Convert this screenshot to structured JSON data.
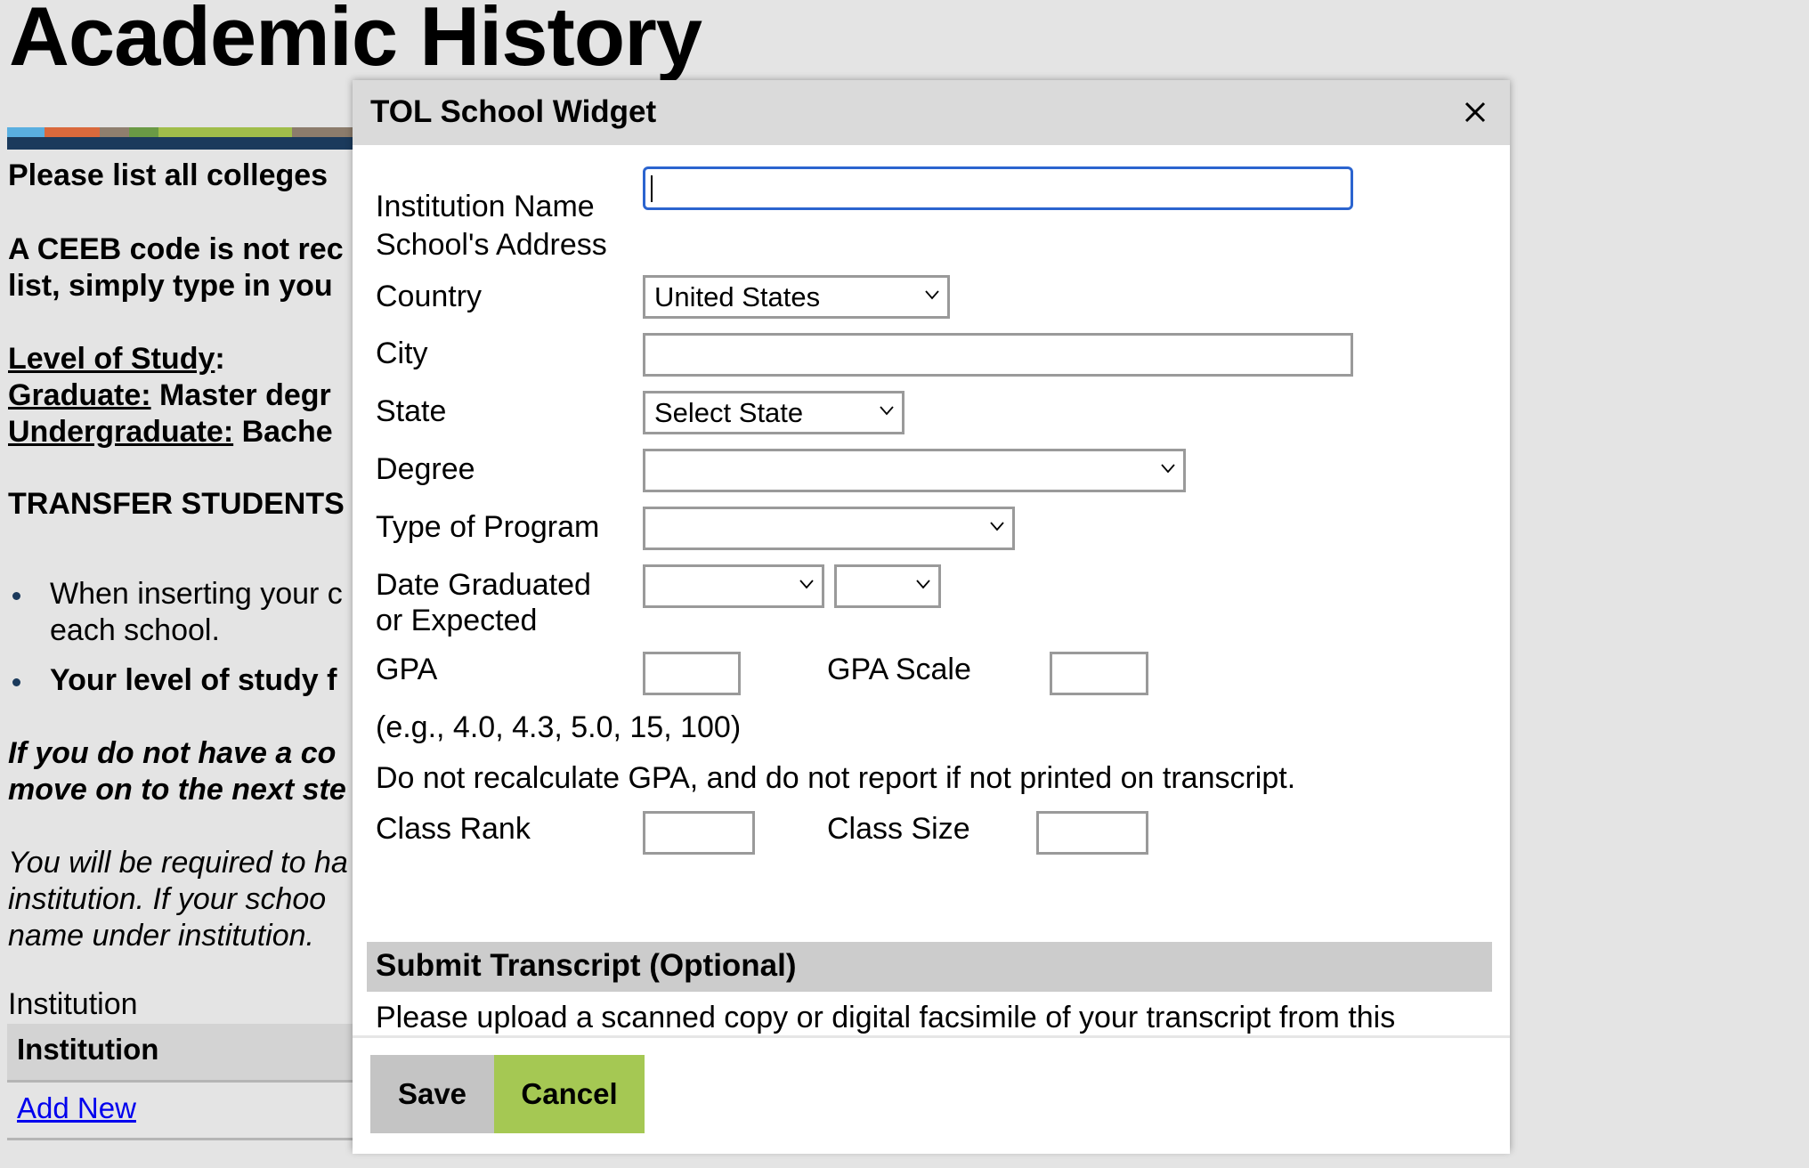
{
  "page": {
    "title": "Academic History",
    "stripe_colors": [
      "#5aafe0",
      "#d9693c",
      "#8f7f6e",
      "#6a9a45",
      "#a0bd4a",
      "#8c7c6c"
    ],
    "stripe_base_color": "#1b3a5c",
    "intro": "Please list all colleges",
    "ceeb_line1": "A CEEB code is not rec",
    "ceeb_line2": "list, simply type in you",
    "level_heading": "Level of Study",
    "level_colon": ":",
    "graduate_label": "Graduate:",
    "graduate_text": " Master degr",
    "undergrad_label": "Undergraduate:",
    "undergrad_text": " Bache",
    "transfer_heading": "TRANSFER STUDENTS",
    "bullets": [
      {
        "line1": "When inserting your c",
        "line2": "each school."
      },
      {
        "line1": "Your level of study f"
      }
    ],
    "no_college_line1": "If you do not have a co",
    "no_college_line2": "move on to the next ste",
    "required_line1": "You will be required to ha",
    "required_line2": "institution.  If your schoo",
    "required_line3": "name under institution.",
    "institution_label": "Institution",
    "table": {
      "header": "Institution",
      "add_new": "Add New"
    }
  },
  "dialog": {
    "title": "TOL School Widget",
    "close_icon": "close-icon",
    "fields": {
      "institution_name": {
        "label": "Institution Name",
        "value": ""
      },
      "address_heading": "School's Address",
      "country": {
        "label": "Country",
        "value": "United States"
      },
      "city": {
        "label": "City",
        "value": ""
      },
      "state": {
        "label": "State",
        "value": "Select State"
      },
      "degree": {
        "label": "Degree",
        "value": ""
      },
      "program_type": {
        "label": "Type of Program",
        "value": ""
      },
      "date_graduated": {
        "label_line1": "Date Graduated",
        "label_line2": "or Expected",
        "month": "",
        "year": ""
      },
      "gpa": {
        "label": "GPA",
        "value": ""
      },
      "gpa_scale": {
        "label": "GPA Scale",
        "value": ""
      },
      "gpa_example": "(e.g., 4.0, 4.3, 5.0, 15, 100)",
      "gpa_note": "Do not recalculate GPA, and do not report if not printed on transcript.",
      "class_rank": {
        "label": "Class Rank",
        "value": ""
      },
      "class_size": {
        "label": "Class Size",
        "value": ""
      }
    },
    "transcript": {
      "heading": "Submit Transcript (Optional)",
      "text": "Please upload a scanned copy or digital facsimile of your transcript from this institution. You may upload those pages now as a single- or multi-page PDF, or each page as an image file. Your scanned document may be large and may take some time to upload, so please be patient while it is processed before continuing."
    },
    "buttons": {
      "save": "Save",
      "cancel": "Cancel"
    },
    "colors": {
      "save_bg": "#c4c4c4",
      "cancel_bg": "#a5c853",
      "focus_border": "#2b64cf"
    }
  }
}
